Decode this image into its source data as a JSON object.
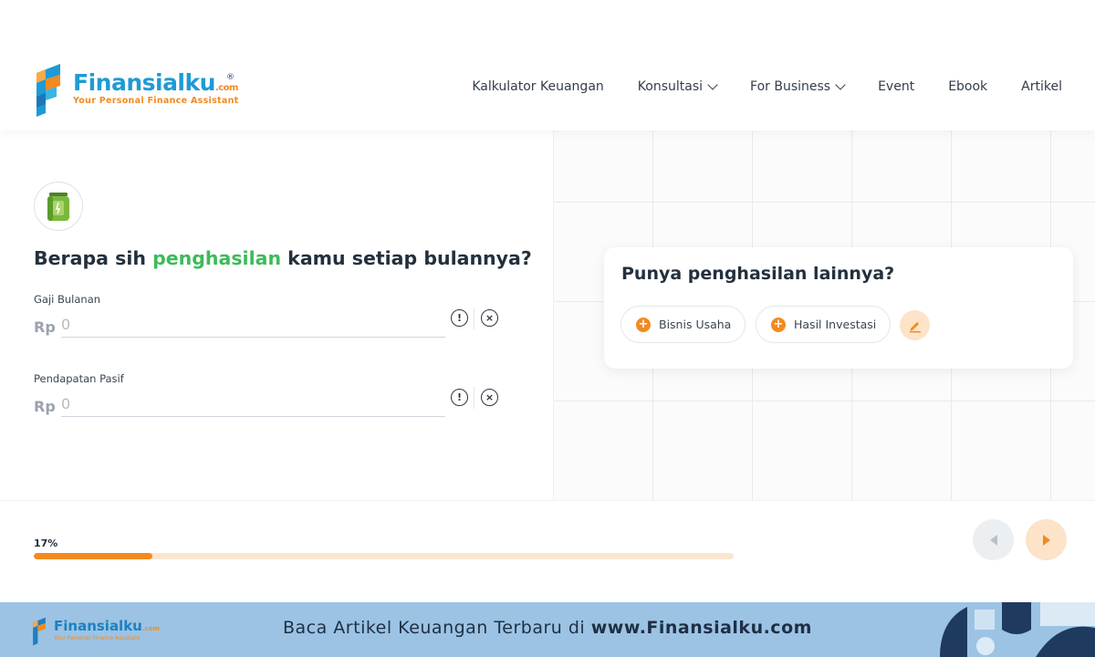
{
  "brand": {
    "name": "Finansialku",
    "com": ".com",
    "reg": "®",
    "tagline": "Your Personal Finance Assistant"
  },
  "nav": {
    "items": [
      {
        "label": "Kalkulator Keuangan",
        "dropdown": false
      },
      {
        "label": "Konsultasi",
        "dropdown": true
      },
      {
        "label": "For Business",
        "dropdown": true
      },
      {
        "label": "Event",
        "dropdown": false
      },
      {
        "label": "Ebook",
        "dropdown": false
      },
      {
        "label": "Artikel",
        "dropdown": false
      }
    ]
  },
  "form": {
    "question_pre": "Berapa sih ",
    "question_highlight": "penghasilan",
    "question_post": " kamu setiap bulannya?",
    "fields": [
      {
        "label": "Gaji Bulanan",
        "currency": "Rp",
        "placeholder": "0"
      },
      {
        "label": "Pendapatan Pasif",
        "currency": "Rp",
        "placeholder": "0"
      }
    ],
    "info_icon": "!",
    "clear_icon": "×"
  },
  "other_income": {
    "title": "Punya penghasilan lainnya?",
    "chips": [
      {
        "label": "Bisnis Usaha"
      },
      {
        "label": "Hasil Investasi"
      }
    ],
    "plus": "+"
  },
  "progress": {
    "label": "17%",
    "value": 0.17
  },
  "banner": {
    "text_pre": "Baca Artikel Keuangan Terbaru di ",
    "text_url": "www.Finansialku.com",
    "logo_name": "Finansialku",
    "logo_com": ".com",
    "logo_tag": "Your Personal Finance Assistant"
  },
  "colors": {
    "accent": "#f28a21",
    "brand_blue": "#1e9ad6",
    "highlight_green": "#3dbb5a",
    "banner_bg": "#9cc3e4"
  }
}
